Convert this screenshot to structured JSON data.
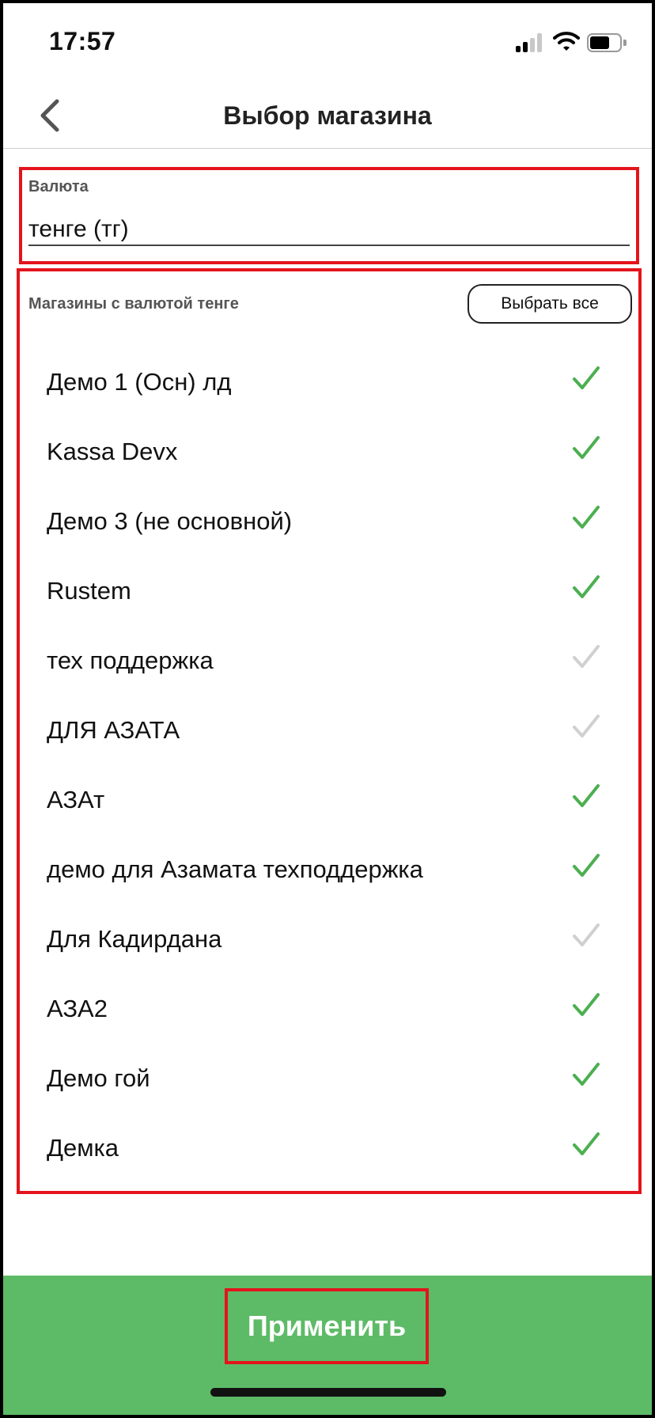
{
  "status_bar": {
    "time": "17:57"
  },
  "nav": {
    "title": "Выбор магазина",
    "back_icon": "chevron-left-icon"
  },
  "currency": {
    "label": "Валюта",
    "value": "тенге (тг)"
  },
  "stores": {
    "header_label": "Магазины с валютой тенге",
    "select_all_label": "Выбрать все",
    "items": [
      {
        "name": "Демо 1 (Осн) лд",
        "checked": true
      },
      {
        "name": "Kassa Devx",
        "checked": true
      },
      {
        "name": "Демо 3 (не основной)",
        "checked": true
      },
      {
        "name": "Rustem",
        "checked": true
      },
      {
        "name": "тех поддержка",
        "checked": false
      },
      {
        "name": "ДЛЯ АЗАТА",
        "checked": false
      },
      {
        "name": "АЗАт",
        "checked": true
      },
      {
        "name": "демо для Азамата техподдержка",
        "checked": true
      },
      {
        "name": "Для Кадирдана",
        "checked": false
      },
      {
        "name": "АЗА2",
        "checked": true
      },
      {
        "name": "Демо гой",
        "checked": true
      },
      {
        "name": "Демка",
        "checked": true
      }
    ]
  },
  "footer": {
    "apply_label": "Применить"
  },
  "colors": {
    "accent_green": "#5dbb67",
    "check_on": "#4caf50",
    "check_off": "#d0d0d0",
    "highlight_red": "#e3141c"
  }
}
